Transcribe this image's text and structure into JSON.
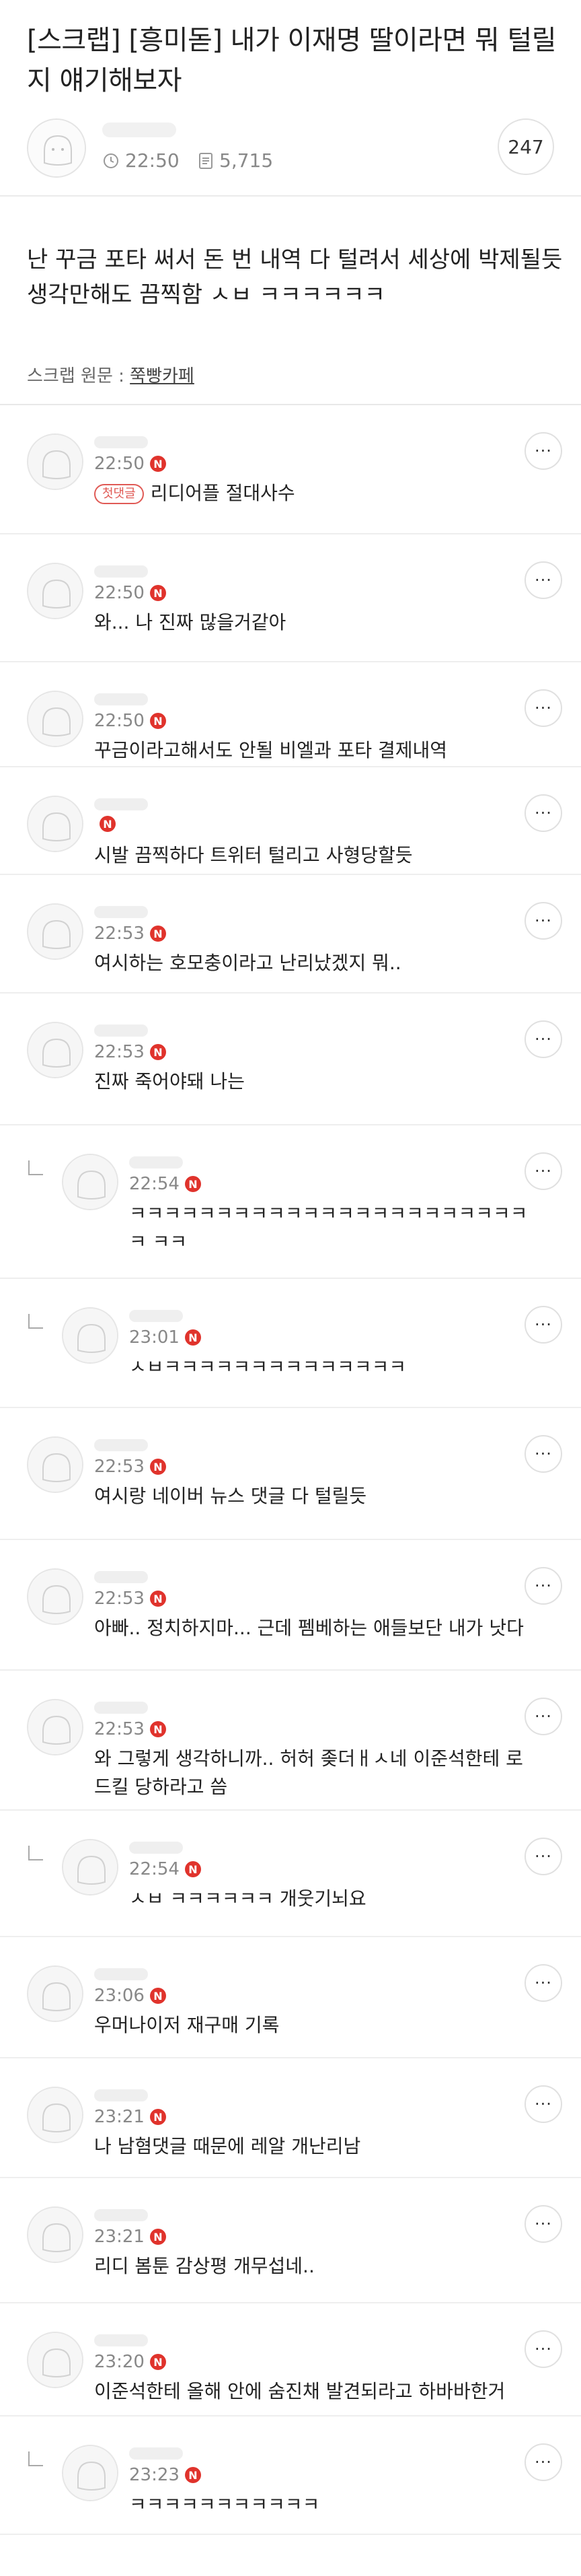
{
  "post": {
    "title": "[스크랩] [흥미돋] 내가 이재명 딸이라면 뭐 털릴지 얘기해보자",
    "time": "22:50",
    "views": "5,715",
    "comment_count": "247",
    "body": "난 꾸금 포타 써서 돈 번 내역 다 털려서 세상에 박제될듯 생각만해도 끔찍함 ㅅㅂ ㅋㅋㅋㅋㅋㅋ",
    "scrap_label": "스크랩 원문 : ",
    "scrap_source": "쭉빵카페"
  },
  "icons": {
    "clock": "clock-icon",
    "views": "document-icon",
    "more": "more-dots-icon",
    "badge": "n-badge"
  },
  "colors": {
    "badge_red": "#e0332c",
    "first_badge": "#e05a55"
  },
  "comments": [
    {
      "time": "22:50",
      "text": "리디어플 절대사수",
      "badge": "첫댓글"
    },
    {
      "time": "22:50",
      "text": "와... 나 진짜 많을거같아"
    },
    {
      "time": "22:50",
      "text": "꾸금이라고해서도 안될 비엘과 포타 결제내역"
    },
    {
      "time": "",
      "text": "시발 끔찍하다 트위터 털리고 사형당할듯"
    },
    {
      "time": "22:53",
      "text": "여시하는 호모충이라고 난리났겠지 뭐.."
    },
    {
      "time": "22:53",
      "text": "진짜 죽어야돼 나는"
    },
    {
      "time": "22:54",
      "text": "ㅋㅋㅋㅋㅋㅋㅋㅋㅋㅋㅋㅋㅋㅋㅋㅋㅋㅋㅋㅋㅋㅋㅋㅋ ㅋㅋ"
    },
    {
      "time": "23:01",
      "text": "ㅅㅂㅋㅋㅋㅋㅋㅋㅋㅋㅋㅋㅋㅋㅋㅋ"
    },
    {
      "time": "22:53",
      "text": "여시랑 네이버 뉴스 댓글 다 털릴듯"
    },
    {
      "time": "22:53",
      "text": "아빠.. 정치하지마... 근데 펨베하는 애들보단 내가 낫다"
    },
    {
      "time": "22:53",
      "text": "와 그렇게 생각하니까.. 허허 좆더ㅐㅅ네 이준석한테 로드킬 당하라고 씀"
    },
    {
      "time": "22:54",
      "text": "ㅅㅂ ㅋㅋㅋㅋㅋㅋ 개웃기뇌요"
    },
    {
      "time": "23:06",
      "text": "우머나이저 재구매 기록"
    },
    {
      "time": "23:21",
      "text": "나 남혐댓글 때문에 레알 개난리남"
    },
    {
      "time": "23:21",
      "text": "리디 봄툰 감상평 개무섭네.."
    },
    {
      "time": "23:20",
      "text": "이준석한테 올해 안에 숨진채 발견되라고 하바바한거"
    },
    {
      "time": "23:23",
      "text": "ㅋㅋㅋㅋㅋㅋㅋㅋㅋㅋㅋ"
    }
  ]
}
